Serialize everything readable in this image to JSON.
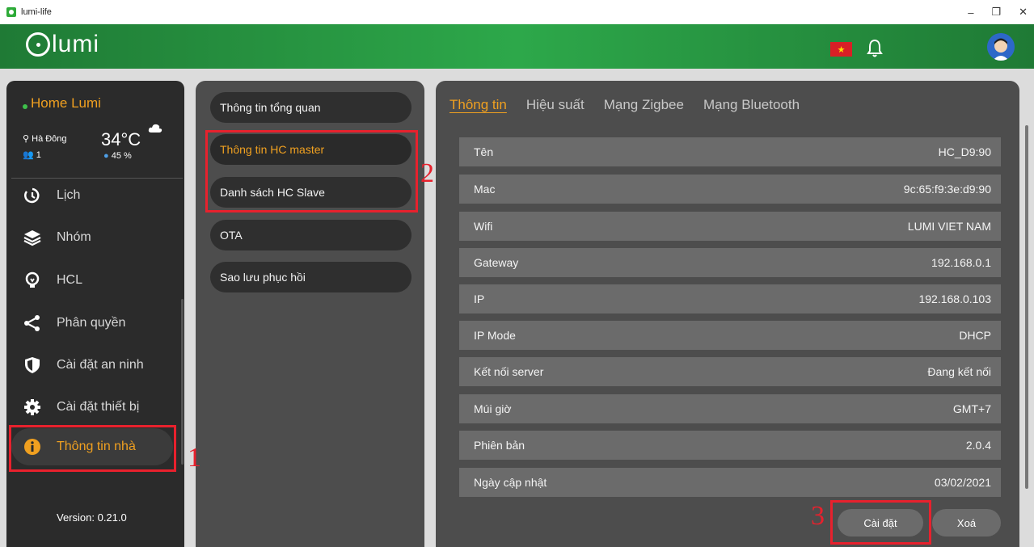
{
  "window": {
    "title": "lumi-life",
    "minimize": "–",
    "maximize": "❐",
    "close": "✕"
  },
  "header": {
    "logo_text": "lumi",
    "flag_star": "★"
  },
  "home": {
    "name": "Home Lumi",
    "location": "Hà Đông",
    "members": "1",
    "temperature": "34°C",
    "humidity": "45 %"
  },
  "sidebar": {
    "items": [
      {
        "label": "Lịch",
        "icon": "clock-icon"
      },
      {
        "label": "Nhóm",
        "icon": "layers-icon"
      },
      {
        "label": "HCL",
        "icon": "bulb-icon"
      },
      {
        "label": "Phân quyền",
        "icon": "share-icon"
      },
      {
        "label": "Cài đặt an ninh",
        "icon": "shield-icon"
      },
      {
        "label": "Cài đặt thiết bị",
        "icon": "gear-icon"
      },
      {
        "label": "Thông tin nhà",
        "icon": "info-icon"
      }
    ],
    "version": "Version: 0.21.0"
  },
  "menu": {
    "items": [
      "Thông tin tổng quan",
      "Thông tin HC master",
      "Danh sách HC Slave",
      "OTA",
      "Sao lưu phục hồi"
    ]
  },
  "tabs": [
    "Thông tin",
    "Hiệu suất",
    "Mạng Zigbee",
    "Mạng Bluetooth"
  ],
  "info_rows": [
    {
      "label": "Tên",
      "value": "HC_D9:90"
    },
    {
      "label": "Mac",
      "value": "9c:65:f9:3e:d9:90"
    },
    {
      "label": "Wifi",
      "value": "LUMI VIET NAM"
    },
    {
      "label": "Gateway",
      "value": "192.168.0.1"
    },
    {
      "label": "IP",
      "value": "192.168.0.103"
    },
    {
      "label": "IP Mode",
      "value": "DHCP"
    },
    {
      "label": "Kết nối server",
      "value": "Đang kết nối"
    },
    {
      "label": "Múi giờ",
      "value": "GMT+7"
    },
    {
      "label": "Phiên bản",
      "value": "2.0.4"
    },
    {
      "label": "Ngày cập nhật",
      "value": "03/02/2021"
    }
  ],
  "actions": {
    "settings": "Cài đặt",
    "delete": "Xoá"
  },
  "annotations": {
    "one": "1",
    "two": "2",
    "three": "3"
  },
  "colors": {
    "accent": "#f0a020",
    "header_green": "#2da84a",
    "annotation_red": "#e8212d"
  }
}
